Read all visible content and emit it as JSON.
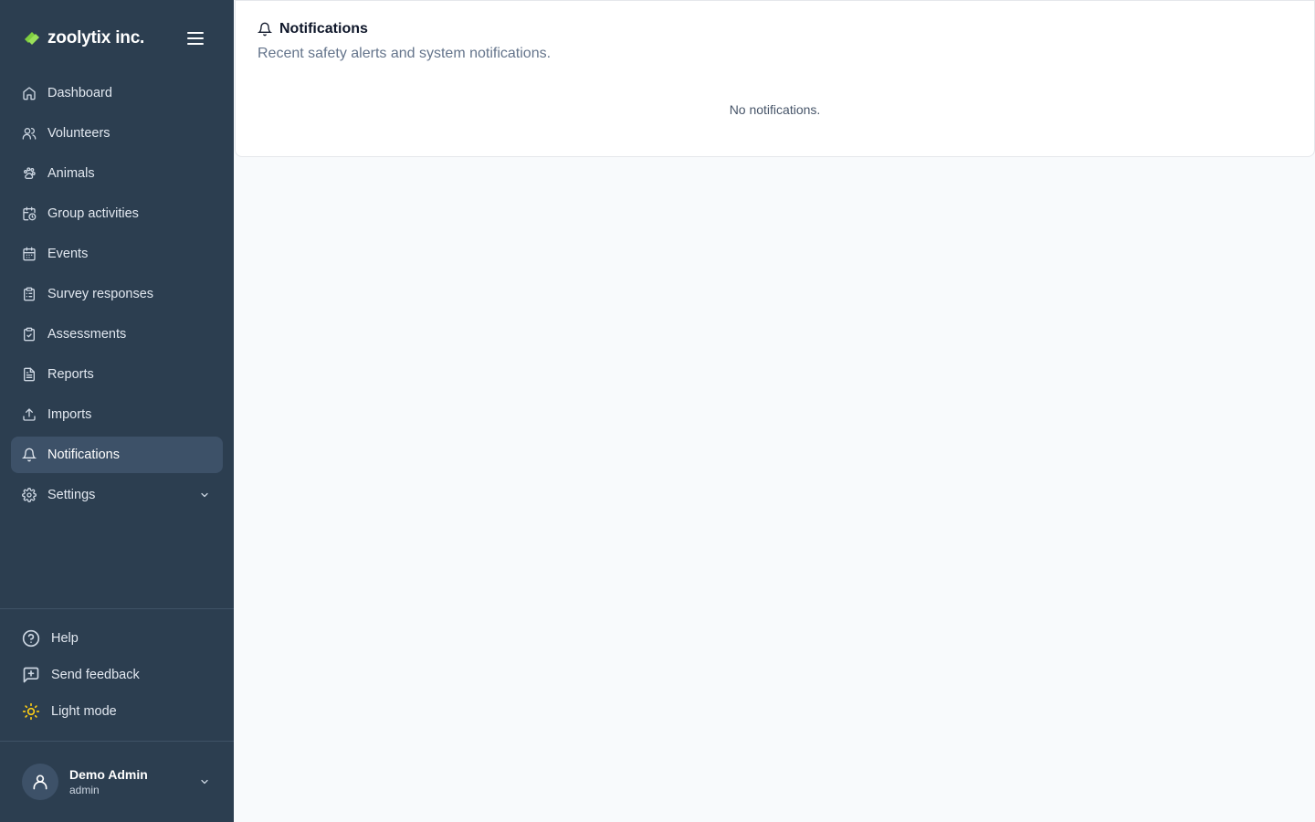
{
  "brand": {
    "name": "zoolytix inc.",
    "accent": "#7fcf3f"
  },
  "nav": {
    "items": [
      {
        "label": "Dashboard",
        "icon": "home-icon"
      },
      {
        "label": "Volunteers",
        "icon": "users-icon"
      },
      {
        "label": "Animals",
        "icon": "paw-icon"
      },
      {
        "label": "Group activities",
        "icon": "calendar-clock-icon"
      },
      {
        "label": "Events",
        "icon": "calendar-icon"
      },
      {
        "label": "Survey responses",
        "icon": "clipboard-list-icon"
      },
      {
        "label": "Assessments",
        "icon": "clipboard-check-icon"
      },
      {
        "label": "Reports",
        "icon": "file-text-icon"
      },
      {
        "label": "Imports",
        "icon": "upload-icon"
      },
      {
        "label": "Notifications",
        "icon": "bell-icon",
        "active": true
      },
      {
        "label": "Settings",
        "icon": "gear-icon",
        "expandable": true
      }
    ]
  },
  "bottom": {
    "help": "Help",
    "feedback": "Send feedback",
    "theme": "Light mode",
    "theme_icon_color": "#facc15"
  },
  "user": {
    "name": "Demo Admin",
    "role": "admin"
  },
  "page": {
    "title": "Notifications",
    "subtitle": "Recent safety alerts and system notifications.",
    "empty_message": "No notifications."
  }
}
